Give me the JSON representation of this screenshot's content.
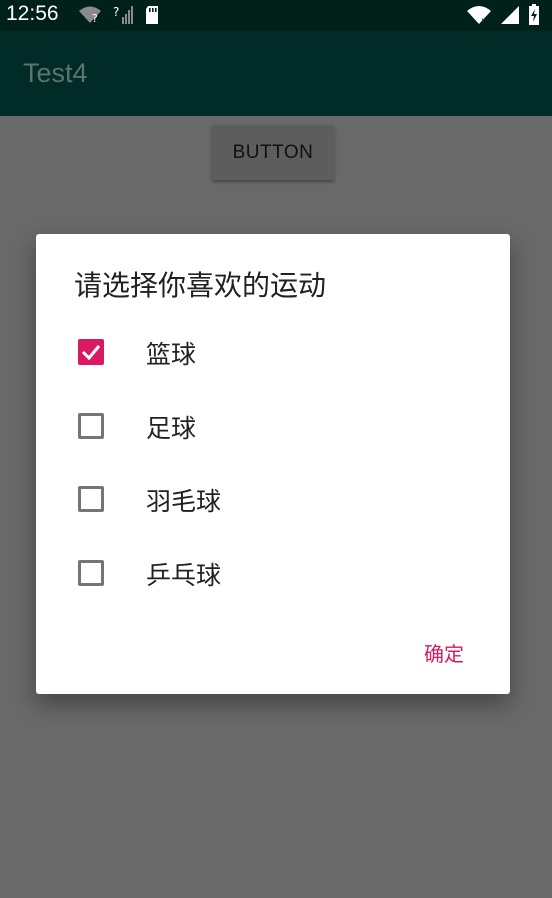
{
  "status_bar": {
    "time": "12:56",
    "left_icons": [
      "wifi-question-icon",
      "signal-question-icon",
      "sd-card-icon"
    ],
    "right_icons": [
      "wifi-icon",
      "signal-icon",
      "battery-icon"
    ]
  },
  "app_bar": {
    "title": "Test4"
  },
  "content": {
    "button_label": "BUTTON"
  },
  "dialog": {
    "title": "请选择你喜欢的运动",
    "options": [
      {
        "label": "篮球",
        "checked": true
      },
      {
        "label": "足球",
        "checked": false
      },
      {
        "label": "羽毛球",
        "checked": false
      },
      {
        "label": "乒乓球",
        "checked": false
      }
    ],
    "confirm_label": "确定"
  },
  "colors": {
    "accent": "#d81b60",
    "app_bar": "#012b26",
    "status_bar": "#00201a",
    "scrim": "#696969"
  }
}
